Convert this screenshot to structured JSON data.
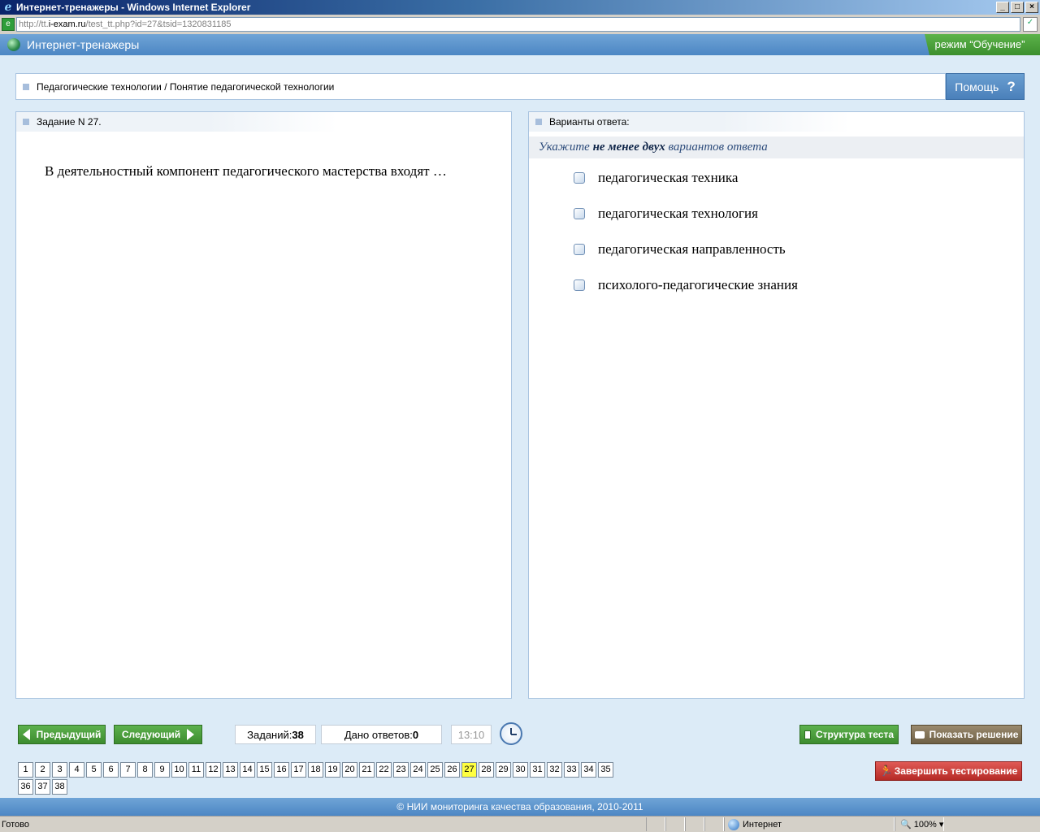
{
  "window": {
    "title": "Интернет-тренажеры - Windows Internet Explorer",
    "url_prefix": "http://tt.",
    "url_host": "i-exam.ru",
    "url_path": "/test_tt.php?id=27&tsid=1320831185"
  },
  "app": {
    "title": "Интернет-тренажеры",
    "mode": "режим “Обучение”",
    "breadcrumb": "Педагогические технологии / Понятие педагогической технологии",
    "help_label": "Помощь",
    "help_glyph": "?"
  },
  "task": {
    "header": "Задание N 27.",
    "question": "В деятельностный компонент педагогического мастерства входят …"
  },
  "answers": {
    "header": "Варианты ответа:",
    "instruction_pre": "Укажите ",
    "instruction_bold": "не менее двух",
    "instruction_post": " вариантов ответа",
    "options": [
      "педагогическая техника",
      "педагогическая технология",
      "педагогическая направленность",
      "психолого-педагогические знания"
    ]
  },
  "toolbar": {
    "prev_label": "Предыдущий",
    "next_label": "Следующий",
    "tasks_label": "Заданий: ",
    "tasks_count": "38",
    "answered_label": "Дано ответов:",
    "answered_count": "0",
    "timer": "13:10",
    "structure_label": "Структура теста",
    "solution_label": "Показать решение",
    "finish_label": "Завершить тестирование"
  },
  "pager": {
    "current": 27,
    "pages": [
      "1",
      "2",
      "3",
      "4",
      "5",
      "6",
      "7",
      "8",
      "9",
      "10",
      "11",
      "12",
      "13",
      "14",
      "15",
      "16",
      "17",
      "18",
      "19",
      "20",
      "21",
      "22",
      "23",
      "24",
      "25",
      "26",
      "27",
      "28",
      "29",
      "30",
      "31",
      "32",
      "33",
      "34",
      "35",
      "36",
      "37",
      "38"
    ]
  },
  "footer": "© НИИ мониторинга качества образования, 2010-2011",
  "statusbar": {
    "status": "Готово",
    "zone": "Интернет",
    "zoom": "100%"
  },
  "colors": {
    "accent_blue": "#4c86c4",
    "green_button": "#3d8c2f",
    "red_button": "#b52a26",
    "current_page": "#ffff40"
  }
}
